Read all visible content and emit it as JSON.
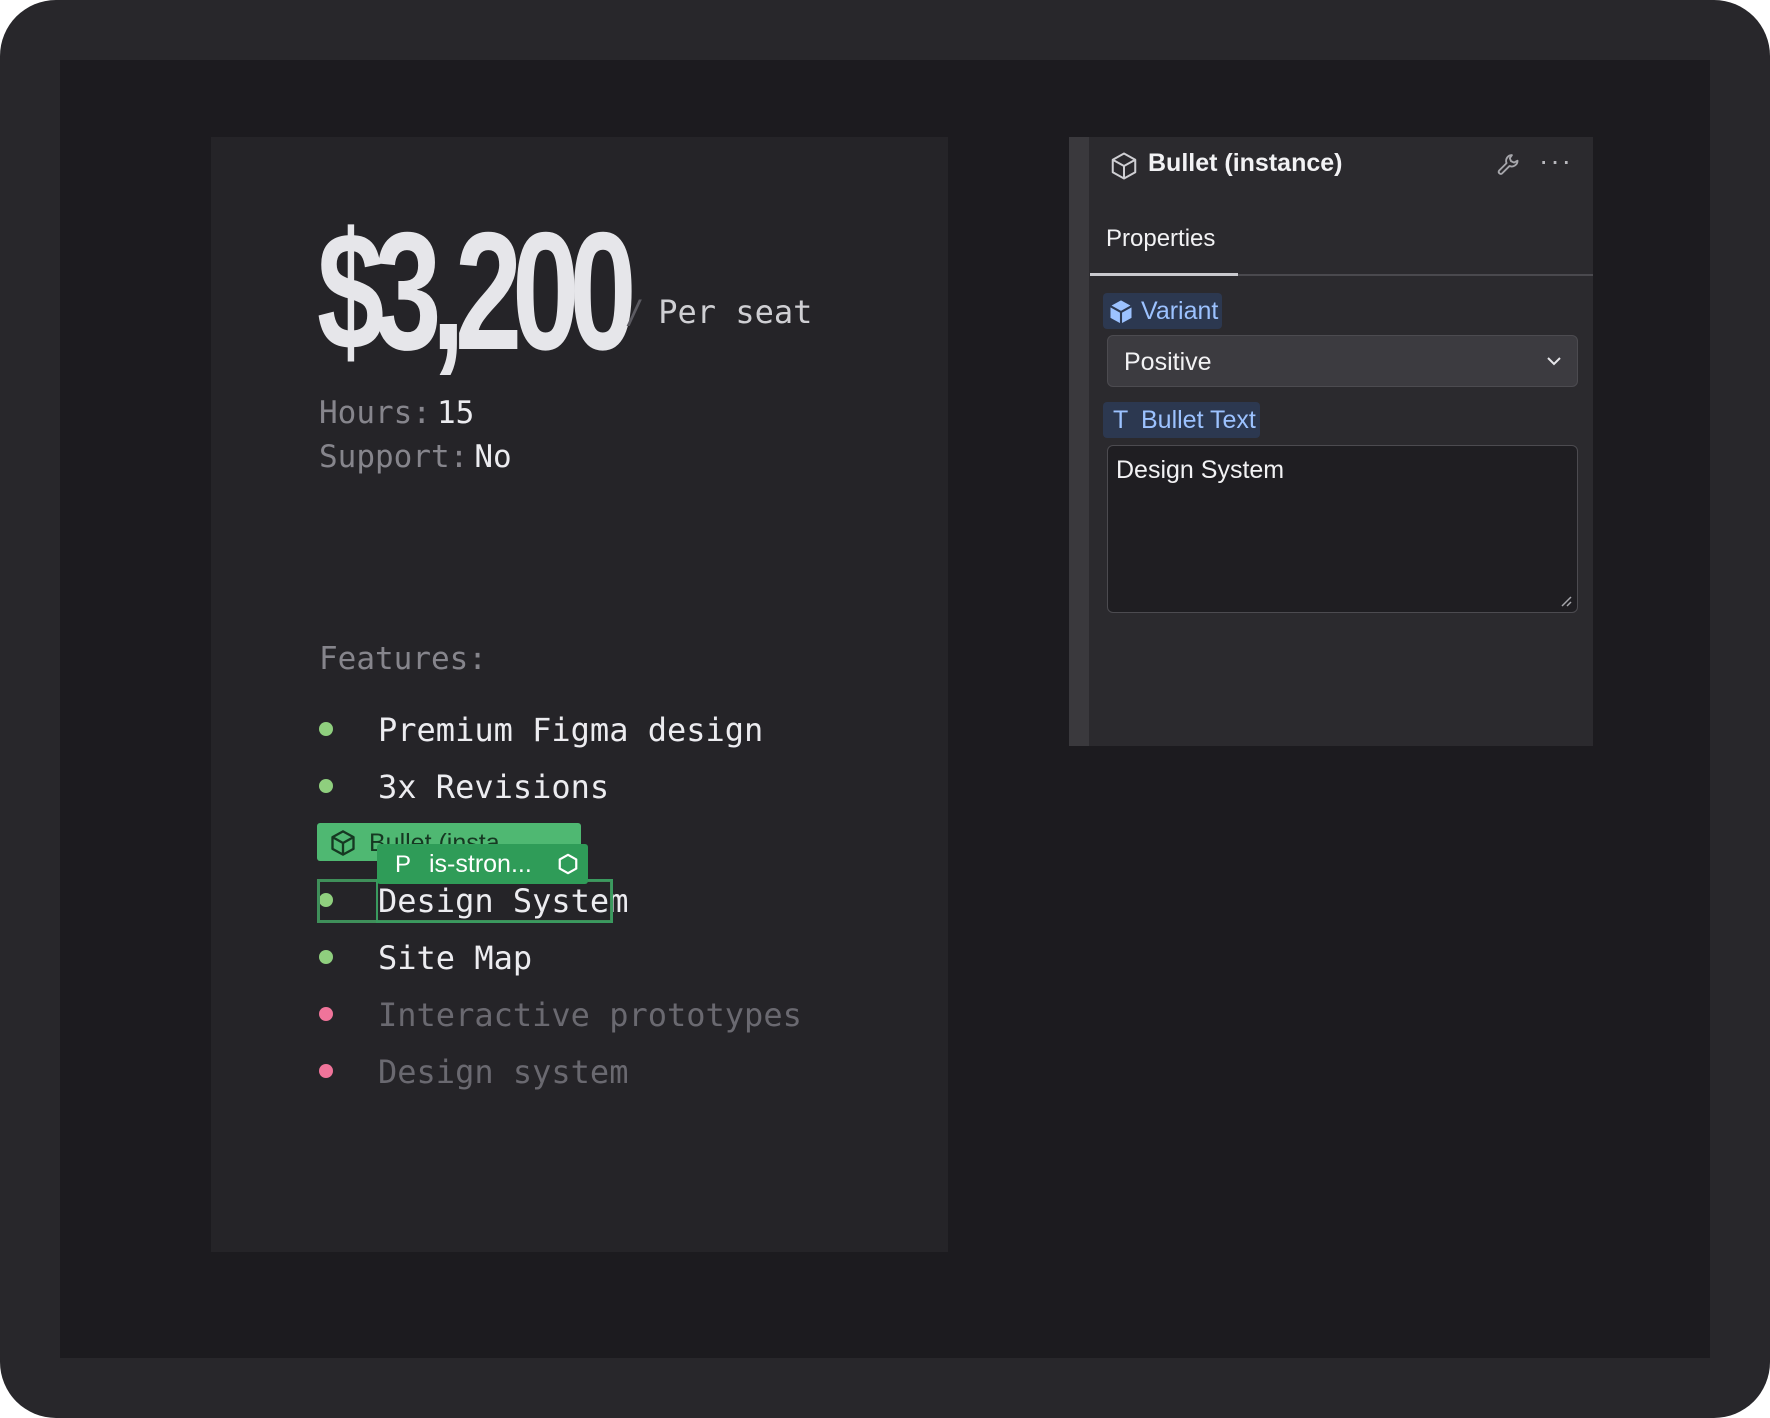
{
  "card": {
    "price": "$3,200",
    "per_slash": "/",
    "per_label": "Per seat",
    "hours_key": "Hours:",
    "hours_value": "15",
    "support_key": "Support:",
    "support_value": "No",
    "features_label": "Features:",
    "features": [
      {
        "text": "Premium Figma design",
        "status": "positive"
      },
      {
        "text": "3x Revisions",
        "status": "positive"
      },
      {
        "text": "Design System",
        "status": "positive",
        "selected": true
      },
      {
        "text": "Site Map",
        "status": "positive"
      },
      {
        "text": "Interactive prototypes",
        "status": "negative"
      },
      {
        "text": "Design system",
        "status": "negative"
      }
    ]
  },
  "selection": {
    "component_tag": "Bullet (insta",
    "prop_tag_letter": "P",
    "prop_tag": "is-stron..."
  },
  "panel": {
    "title": "Bullet (instance)",
    "more_label": "···",
    "tab": "Properties",
    "variant_label": "Variant",
    "variant_value": "Positive",
    "text_label_glyph": "T",
    "text_label": "Bullet Text",
    "text_value": "Design System"
  },
  "colors": {
    "positive": "#8fcf7e",
    "negative": "#f0749a",
    "selection": "#4fb872",
    "accent_label": "#9cc2ff"
  }
}
